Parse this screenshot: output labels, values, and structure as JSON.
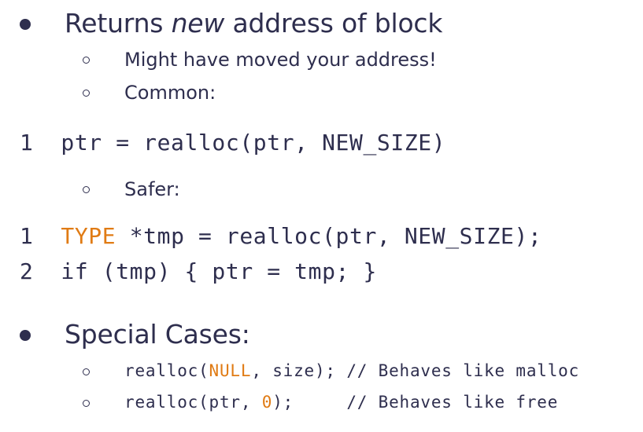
{
  "colors": {
    "text": "#2e2e4e",
    "keyword_highlight": "#e07b14"
  },
  "bullets": [
    {
      "pre": "Returns ",
      "emph": "new",
      "post": " address of block",
      "sub": [
        "Might have moved your address!",
        "Common:"
      ]
    },
    {
      "text": "Special Cases:"
    }
  ],
  "code_common": {
    "line_number": "1",
    "text": "ptr = realloc(ptr, NEW_SIZE)"
  },
  "safer_label": "Safer:",
  "code_safer": [
    {
      "line_number": "1",
      "keyword": "TYPE",
      "rest": " *tmp = realloc(ptr, NEW_SIZE);"
    },
    {
      "line_number": "2",
      "text": "if (tmp) { ptr = tmp; }"
    }
  ],
  "special_cases": [
    {
      "pre": "realloc(",
      "highlight": "NULL",
      "post": ", size); // Behaves like malloc"
    },
    {
      "pre": "realloc(ptr, ",
      "highlight": "0",
      "post": ");     // Behaves like free"
    }
  ]
}
